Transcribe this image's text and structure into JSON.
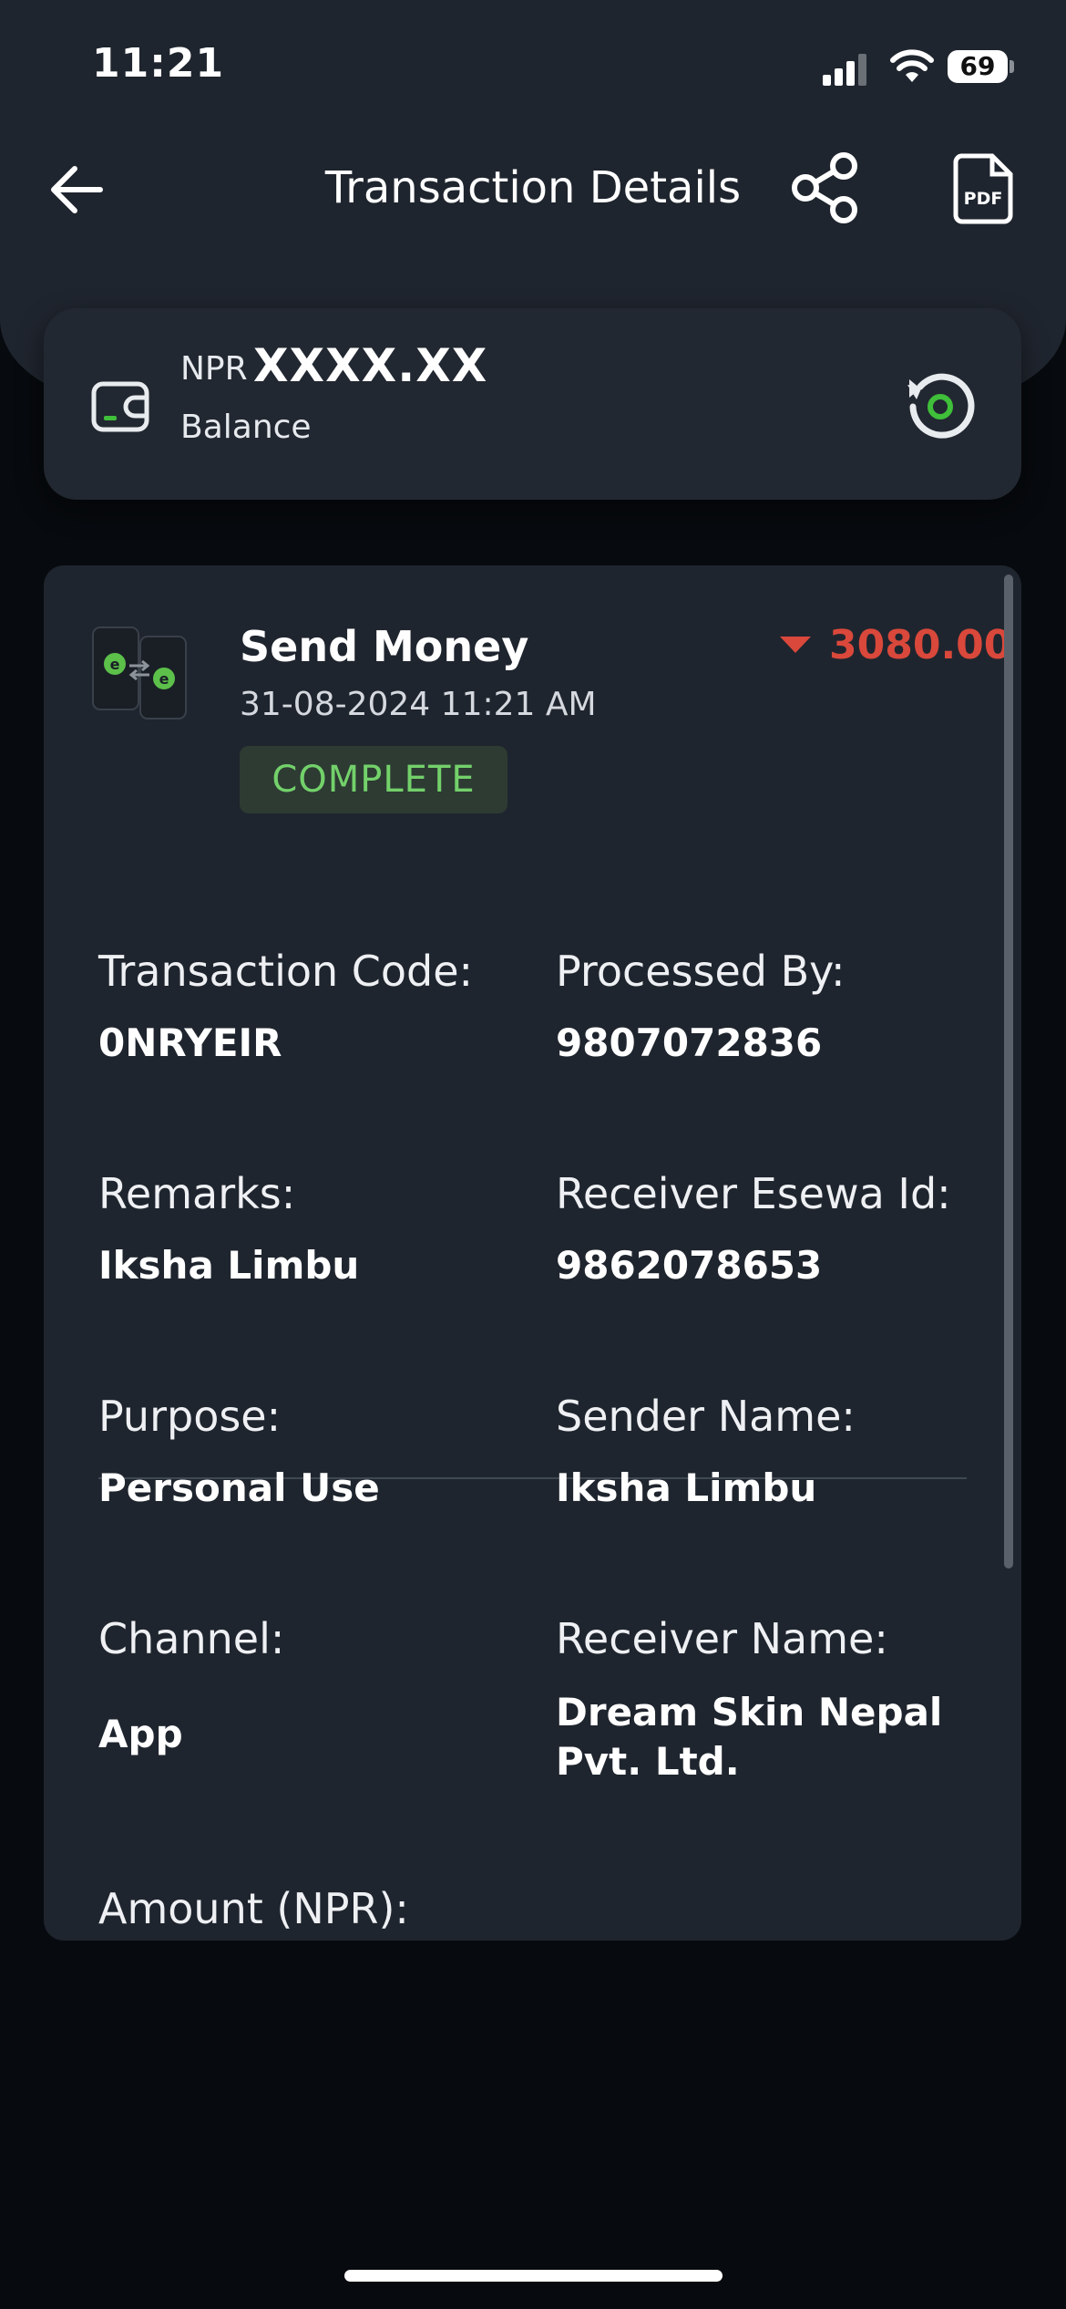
{
  "status_bar": {
    "time": "11:21",
    "battery": "69"
  },
  "header": {
    "title": "Transaction Details"
  },
  "balance": {
    "currency": "NPR",
    "value": "XXXX.XX",
    "label": "Balance"
  },
  "transaction": {
    "type": "Send Money",
    "datetime": "31-08-2024 11:21 AM",
    "status": "COMPLETE",
    "amount": "3080.00",
    "amount_color": "#d9483b",
    "status_color": "#73d16a"
  },
  "details": {
    "transaction_code_label": "Transaction Code:",
    "transaction_code": "0NRYEIR",
    "processed_by_label": "Processed By:",
    "processed_by": "9807072836",
    "remarks_label": "Remarks:",
    "remarks": "Iksha Limbu",
    "receiver_esewa_id_label": "Receiver Esewa Id:",
    "receiver_esewa_id": "9862078653",
    "purpose_label": "Purpose:",
    "purpose": "Personal Use",
    "sender_name_label": "Sender Name:",
    "sender_name": "Iksha Limbu",
    "channel_label": "Channel:",
    "channel": "App",
    "receiver_name_label": "Receiver Name:",
    "receiver_name_line1": "Dream Skin Nepal",
    "receiver_name_line2": "Pvt. Ltd.",
    "amount_label": "Amount (NPR):"
  },
  "icons": {
    "back": "arrow-left-icon",
    "share": "share-icon",
    "pdf": "pdf-icon",
    "wallet": "wallet-icon",
    "refresh": "refresh-icon",
    "send_money": "send-money-icon"
  }
}
